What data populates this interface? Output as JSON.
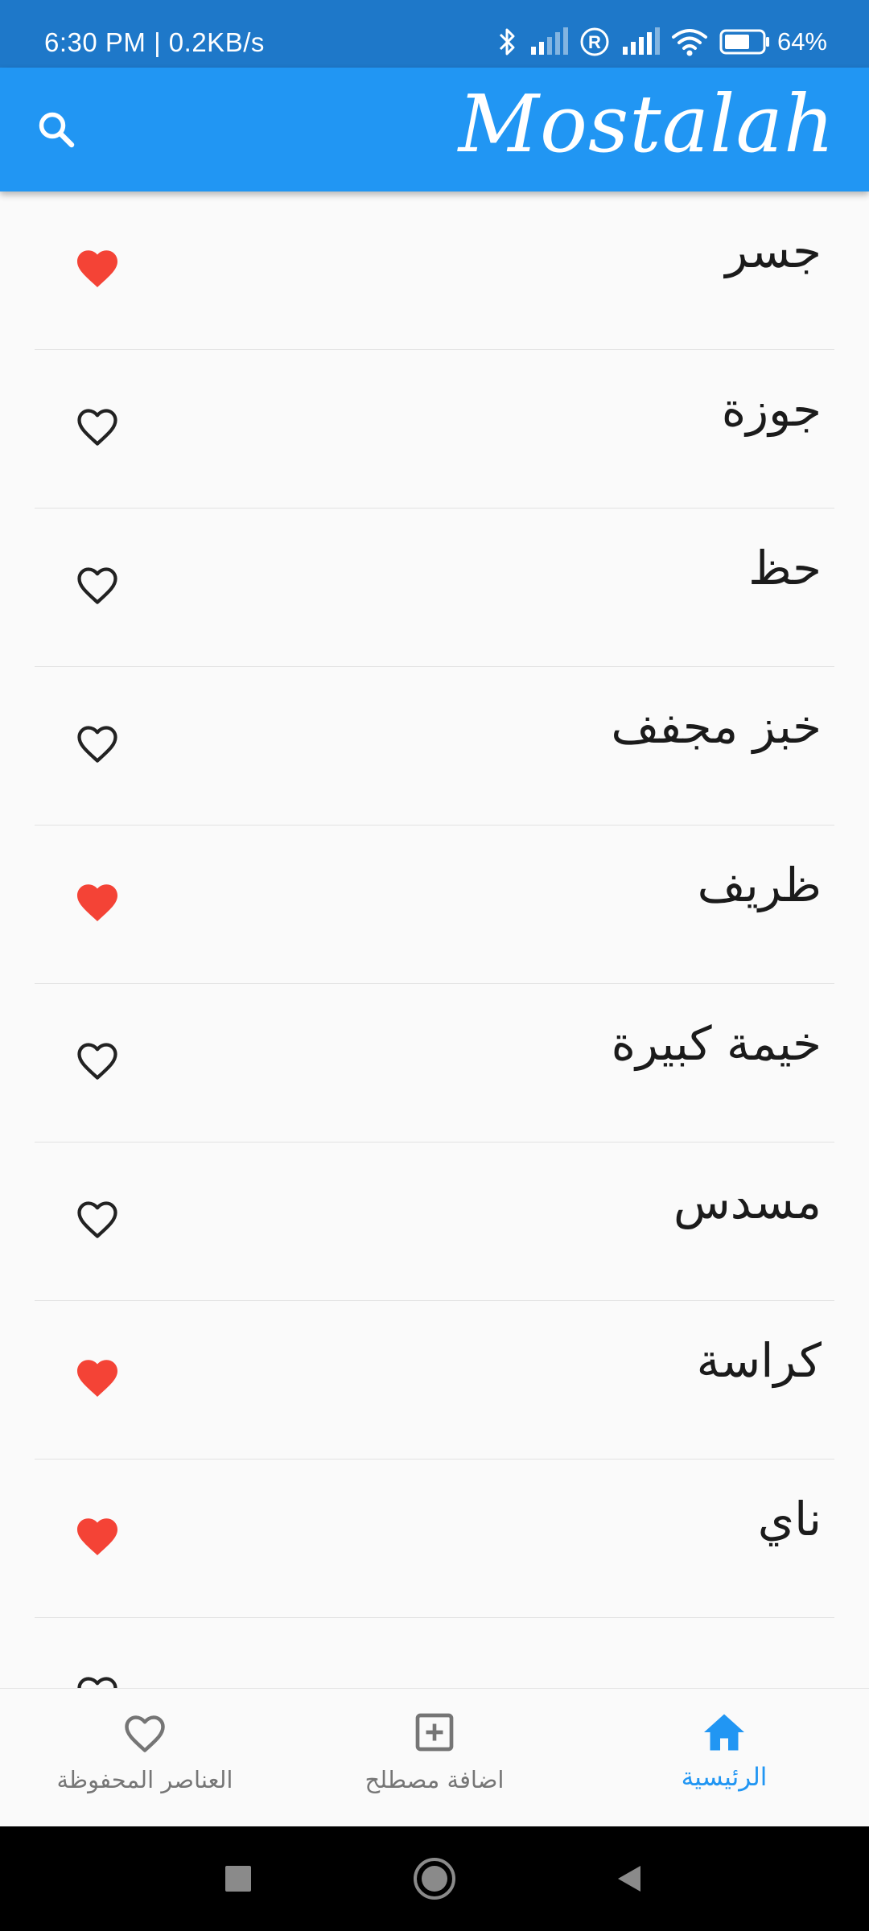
{
  "status_bar": {
    "time_speed": "6:30 PM | 0.2KB/s",
    "battery_percent": "64%",
    "icons": [
      "bluetooth-icon",
      "signal-icon",
      "roaming-icon",
      "signal-icon",
      "wifi-icon",
      "battery-icon"
    ]
  },
  "app_bar": {
    "title": "Mostalah",
    "search_icon": "search-icon",
    "color": "#2196f3"
  },
  "terms": [
    {
      "term": "جسر",
      "favorite": true
    },
    {
      "term": "جوزة",
      "favorite": false
    },
    {
      "term": "حظ",
      "favorite": false
    },
    {
      "term": "خبز مجفف",
      "favorite": false
    },
    {
      "term": "ظريف",
      "favorite": true
    },
    {
      "term": "خيمة كبيرة",
      "favorite": false
    },
    {
      "term": "مسدس",
      "favorite": false
    },
    {
      "term": "كراسة",
      "favorite": true
    },
    {
      "term": "ناي",
      "favorite": true
    },
    {
      "term": "",
      "favorite": false
    }
  ],
  "colors": {
    "favorite_on": "#f44336",
    "favorite_off": "#222222",
    "nav_active": "#2196f3",
    "nav_inactive": "#767676"
  },
  "bottom_nav": {
    "saved_label": "العناصر المحفوظة",
    "add_label": "اضافة مصطلح",
    "home_label": "الرئيسية",
    "active": "home"
  },
  "system_nav": [
    "recents-icon",
    "home-icon",
    "back-icon"
  ]
}
